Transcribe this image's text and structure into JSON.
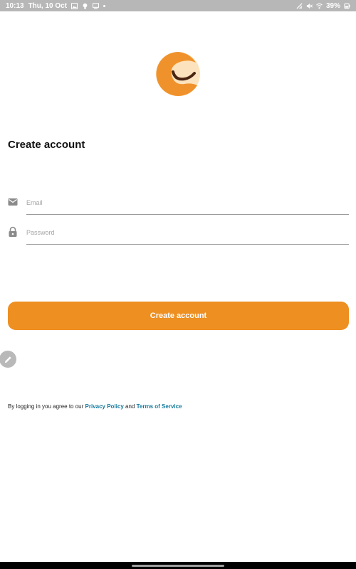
{
  "status_bar": {
    "time": "10:13",
    "date": "Thu, 10 Oct",
    "battery": "39%",
    "left_icons": [
      "gallery-icon",
      "bulb-icon",
      "cast-icon",
      "more-dot-icon"
    ],
    "right_icons": [
      "no-sim-icon",
      "mute-icon",
      "wifi-icon",
      "battery-icon"
    ]
  },
  "logo": {
    "icon": "app-logo-icon",
    "color_primary": "#f0922b",
    "color_secondary": "#fde3bd",
    "smile_color": "#4a2410"
  },
  "screen": {
    "title": "Create account"
  },
  "form": {
    "email": {
      "icon": "mail-icon",
      "placeholder": "Email",
      "value": ""
    },
    "password": {
      "icon": "lock-icon",
      "placeholder": "Password",
      "value": ""
    }
  },
  "submit": {
    "label": "Create account",
    "color": "#ee8f21"
  },
  "edit_fab": {
    "icon": "pencil-icon"
  },
  "terms": {
    "prefix": "By logging in you agree to our",
    "privacy_link": "Privacy Policy",
    "joiner": "and",
    "tos_link": "Terms of Service",
    "link_color": "#137a9c"
  },
  "nav_bar": {
    "icon": "home-handle"
  }
}
